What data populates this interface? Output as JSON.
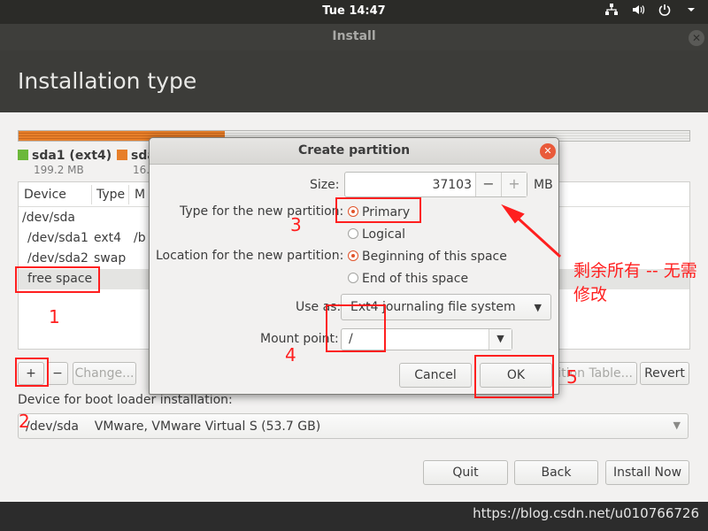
{
  "topbar": {
    "clock": "Tue 14:47",
    "icons": [
      "network-icon",
      "volume-icon",
      "power-icon",
      "menu-arrow-icon"
    ]
  },
  "window": {
    "title": "Install",
    "close_icon": "close-icon"
  },
  "page": {
    "title": "Installation type"
  },
  "partition_bar": {
    "used_fraction": 0.307,
    "colors": {
      "used": "#e77f2a",
      "free": "#e0e0dd"
    }
  },
  "legend": [
    {
      "name": "sda1 (ext4)",
      "size": "199.2 MB",
      "color": "#6cb83a"
    },
    {
      "name": "sda",
      "size": "16.",
      "color": "#e77f2a"
    }
  ],
  "table": {
    "headers": [
      "Device",
      "Type",
      "M"
    ],
    "rows": [
      {
        "device": "/dev/sda",
        "type": "",
        "mount": ""
      },
      {
        "device": "/dev/sda1",
        "type": "ext4",
        "mount": "/b"
      },
      {
        "device": "/dev/sda2",
        "type": "swap",
        "mount": ""
      },
      {
        "device": "free space",
        "type": "",
        "mount": ""
      }
    ]
  },
  "table_buttons": {
    "add": "+",
    "remove": "−",
    "change": "Change...",
    "new_table": "ition Table...",
    "revert": "Revert"
  },
  "boot_loader": {
    "label": "Device for boot loader installation:",
    "value": "/dev/sda    VMware, VMware Virtual S (53.7 GB)"
  },
  "footer_buttons": {
    "quit": "Quit",
    "back": "Back",
    "install_now": "Install Now"
  },
  "dialog": {
    "title": "Create partition",
    "size_label": "Size:",
    "size_value": "37103",
    "size_unit": "MB",
    "minus": "−",
    "plus": "+",
    "type_label": "Type for the new partition:",
    "type_options": [
      {
        "label": "Primary",
        "selected": true
      },
      {
        "label": "Logical",
        "selected": false
      }
    ],
    "location_label": "Location for the new partition:",
    "location_options": [
      {
        "label": "Beginning of this space",
        "selected": true
      },
      {
        "label": "End of this space",
        "selected": false
      }
    ],
    "use_as_label": "Use as:",
    "use_as_value": "Ext4 journaling file system",
    "mount_label": "Mount point:",
    "mount_value": "/",
    "cancel": "Cancel",
    "ok": "OK"
  },
  "annotations": {
    "color": "#ff1f1f",
    "numbers": [
      "1",
      "2",
      "3",
      "4",
      "5"
    ],
    "note": "剩余所有 -- 无需修改"
  },
  "watermark": "https://blog.csdn.net/u010766726"
}
